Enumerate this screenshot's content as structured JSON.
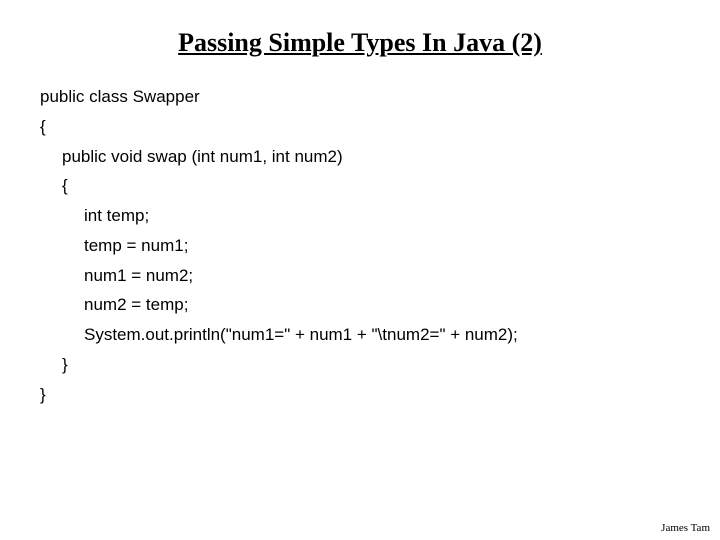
{
  "title": "Passing Simple Types In Java (2)",
  "code": {
    "l0": "public class Swapper",
    "l1": "{",
    "l2": "public void swap (int num1, int num2)",
    "l3": "{",
    "l4": "int temp;",
    "l5": "temp = num1;",
    "l6": "num1 = num2;",
    "l7": "num2 = temp;",
    "l8": "System.out.println(\"num1=\" + num1 + \"\\tnum2=\" + num2);",
    "l9": "}",
    "l10": "}"
  },
  "footer": "James Tam"
}
